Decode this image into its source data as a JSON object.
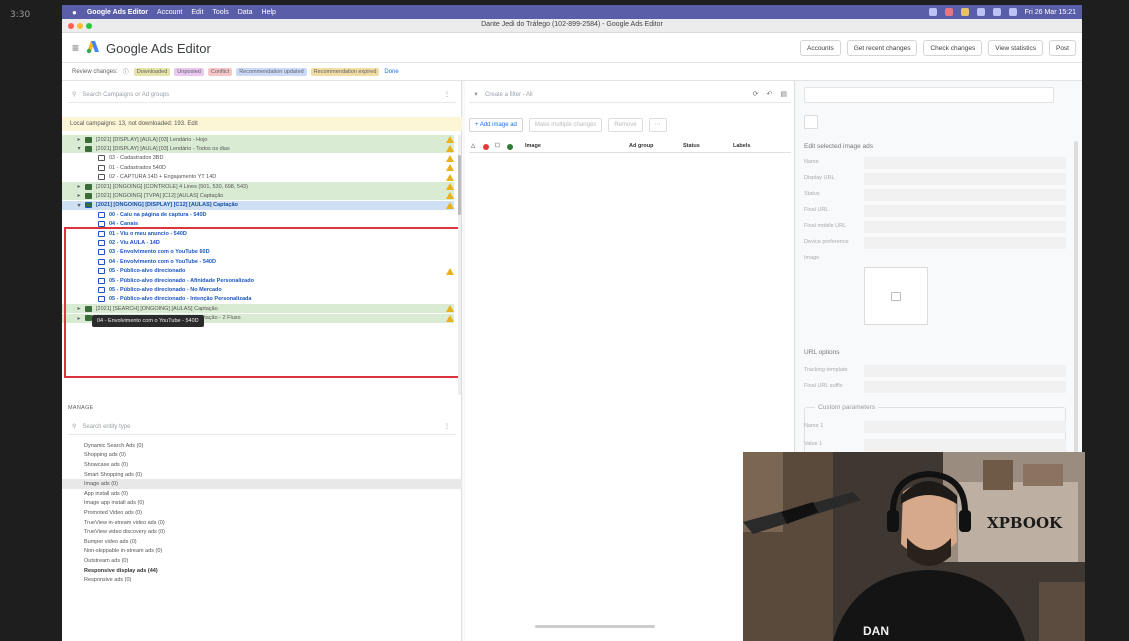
{
  "overlay": {
    "timer": "3:30"
  },
  "menubar": {
    "items": [
      "Google Ads Editor",
      "Account",
      "Edit",
      "Tools",
      "Data",
      "Help"
    ],
    "clock": "Fri 26 Mar 15:21"
  },
  "window": {
    "title": "Dante Jedi do Tráfego (102-899-2584) - Google Ads Editor"
  },
  "header": {
    "app_name": "Google Ads Editor",
    "buttons": [
      "Accounts",
      "Get recent changes",
      "Check changes",
      "View statistics",
      "Post"
    ]
  },
  "review": {
    "label": "Review changes:",
    "chips": [
      {
        "text": "Downloaded",
        "color": "#e6e3a6"
      },
      {
        "text": "Unposted",
        "color": "#e9c7ef"
      },
      {
        "text": "Conflict",
        "color": "#f6c6c6"
      },
      {
        "text": "Recommendation updated",
        "color": "#c9d9f7"
      },
      {
        "text": "Recommendation expired",
        "color": "#f1dca4"
      }
    ],
    "done": "Done"
  },
  "left": {
    "search_placeholder": "Search Campaigns or Ad groups",
    "notice": "Local campaigns: 13, not downloaded: 193. Edit",
    "tree": [
      {
        "text": "[2021] [DISPLAY] [AULA] [03] Lendário - Hojo",
        "type": "camp",
        "open": false,
        "warn": true
      },
      {
        "text": "[2021] [DISPLAY] [AULA] [03] Lendário - Todos os dias",
        "type": "camp",
        "open": true,
        "warn": true
      },
      {
        "text": "03 - Cadastrados 3BD",
        "type": "adg",
        "warn": true
      },
      {
        "text": "01 - Cadastrados 540D",
        "type": "adg",
        "warn": true
      },
      {
        "text": "02 - CAPTURA 14D + Engajamento YT 14D",
        "type": "adg",
        "warn": true
      },
      {
        "text": "[2021] [ONGOING] [CONTROLE] 4 Lines (501, 530, 698, 543)",
        "type": "camp",
        "open": false,
        "warn": true
      },
      {
        "text": "[2021] [ONGOING] [TVPA] [C12] [AULAS] Captação",
        "type": "camp",
        "open": false,
        "warn": true
      },
      {
        "text": "[2021] [ONGOING] [DISPLAY] [C12] [AULAS] Captação",
        "type": "camp",
        "open": true,
        "warn": true,
        "sel": true
      },
      {
        "text": "00 - Caiu na página de captura - 540D",
        "type": "adg",
        "sel": true
      },
      {
        "text": "04 - Canais",
        "type": "adg",
        "sel": true
      },
      {
        "text": "01 - Viu o meu anuncio - 540D",
        "type": "adg",
        "sel": true
      },
      {
        "text": "02 - Viu AULA - 14D",
        "type": "adg",
        "sel": true
      },
      {
        "text": "03 - Envolvimento com o YouTube 60D",
        "type": "adg",
        "sel": true
      },
      {
        "text": "04 - Envolvimento com o YouTube - 540D",
        "type": "adg",
        "sel": true
      },
      {
        "text": "05 - Público-alvo direcionado",
        "type": "adg",
        "sel": true,
        "warn": true
      },
      {
        "text": "05 - Público-alvo direcionado - Afinidade Personalizado",
        "type": "adg",
        "sel": true
      },
      {
        "text": "05 - Público-alvo direcionado - No Mercado",
        "type": "adg",
        "sel": true
      },
      {
        "text": "05 - Público-alvo direcionado - Intenção Personalizada",
        "type": "adg",
        "sel": true
      },
      {
        "text": "[2021] [SEARCH] [ONGOING] [AULAS] Captação",
        "type": "camp",
        "open": false,
        "warn": true
      },
      {
        "text": "[2021] [SEARCH] [ONGOING] [AULAS] Captação - 2 Fluxo",
        "type": "camp",
        "open": false,
        "warn": true
      }
    ],
    "tooltip": "04 - Envolvimento com o YouTube - 540D",
    "manage_label": "MANAGE",
    "manage_search_placeholder": "Search entity type",
    "entity_types": [
      {
        "text": "Dynamic Search Ads (0)"
      },
      {
        "text": "Shopping ads (0)"
      },
      {
        "text": "Showcase ads (0)"
      },
      {
        "text": "Smart Shopping ads (0)"
      },
      {
        "text": "Image ads (0)",
        "sel": true
      },
      {
        "text": "App install ads (0)"
      },
      {
        "text": "Image app install ads (0)"
      },
      {
        "text": "Promoted Video ads (0)"
      },
      {
        "text": "TrueView in-stream video ads (0)"
      },
      {
        "text": "TrueView video discovery ads (0)"
      },
      {
        "text": "Bumper video ads (0)"
      },
      {
        "text": "Non-skippable in-stream ads (0)"
      },
      {
        "text": "Outstream ads (0)"
      },
      {
        "text": "Responsive display ads (44)",
        "bold": true
      },
      {
        "text": "Responsive ads (0)"
      }
    ]
  },
  "middle": {
    "filter_placeholder": "Create a filter - All",
    "add_button": "+ Add image ad",
    "disabled_buttons": [
      "Make multiple changes",
      "Remove",
      "⋯"
    ],
    "columns": [
      "Image",
      "Ad group",
      "Status",
      "Labels"
    ]
  },
  "right": {
    "edit_title": "Edit selected image ads",
    "fields": [
      "Name",
      "Display URL",
      "Status",
      "Final URL",
      "Final mobile URL",
      "Device preference",
      "Image"
    ],
    "url_title": "URL options",
    "url_fields": [
      "Tracking template",
      "Final URL suffix"
    ],
    "custom_title": "Custom parameters",
    "custom_fields": [
      "Name 1",
      "Value 1"
    ]
  },
  "webcam": {
    "brand": "XPBOOK",
    "shirt": "DAN"
  }
}
